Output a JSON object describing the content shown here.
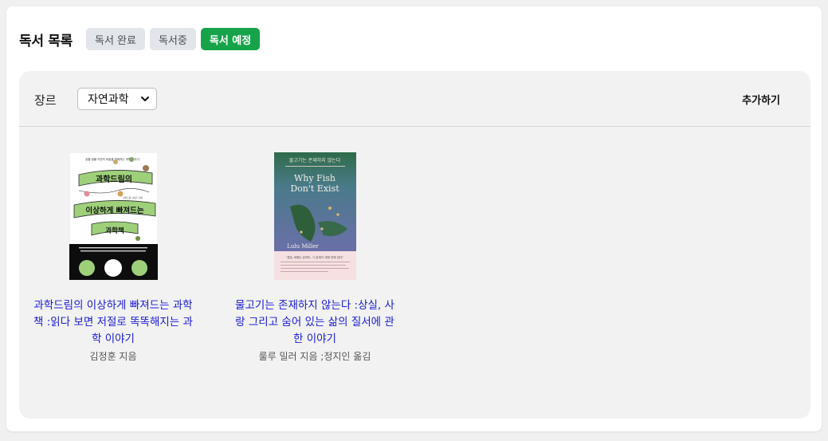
{
  "header": {
    "title": "독서 목록",
    "tabs": [
      {
        "label": "독서 완료",
        "active": false
      },
      {
        "label": "독서중",
        "active": false
      },
      {
        "label": "독서 예정",
        "active": true
      }
    ]
  },
  "toolbar": {
    "genre_label": "장르",
    "genre_selected": "자연과학",
    "add_label": "추가하기"
  },
  "books": [
    {
      "title": "과학드림의 이상하게 빠져드는 과학책 :읽다 보면 저절로 똑똑해지는 과학 이야기",
      "author": "김정훈 지음",
      "cover": {
        "top_text": "공룡·생물·자연의 비밀을 파헤치는 과학 이야기",
        "line1": "과학드림의",
        "line2": "이상하게 빠져드는",
        "line3": "과학책",
        "author_small": "과학드림 김정훈 지음"
      }
    },
    {
      "title": "물고기는 존재하지 않는다 :상실, 사랑 그리고 숨어 있는 삶의 질서에 관한 이야기",
      "author": "룰루 밀러 지음 ;정지인 옮김",
      "cover": {
        "kr_title": "물고기는 존재하지 않는다",
        "en_line1": "Why Fish",
        "en_line2": "Don't Exist",
        "author_en": "Lulu Miller",
        "blurb": "\"혼돈 세계는 있어도, 그 존재가 세계 안에 있다\""
      }
    }
  ],
  "colors": {
    "accent": "#16a34a",
    "link": "#1a1ad6",
    "tab_inactive": "#e2e5e9"
  }
}
